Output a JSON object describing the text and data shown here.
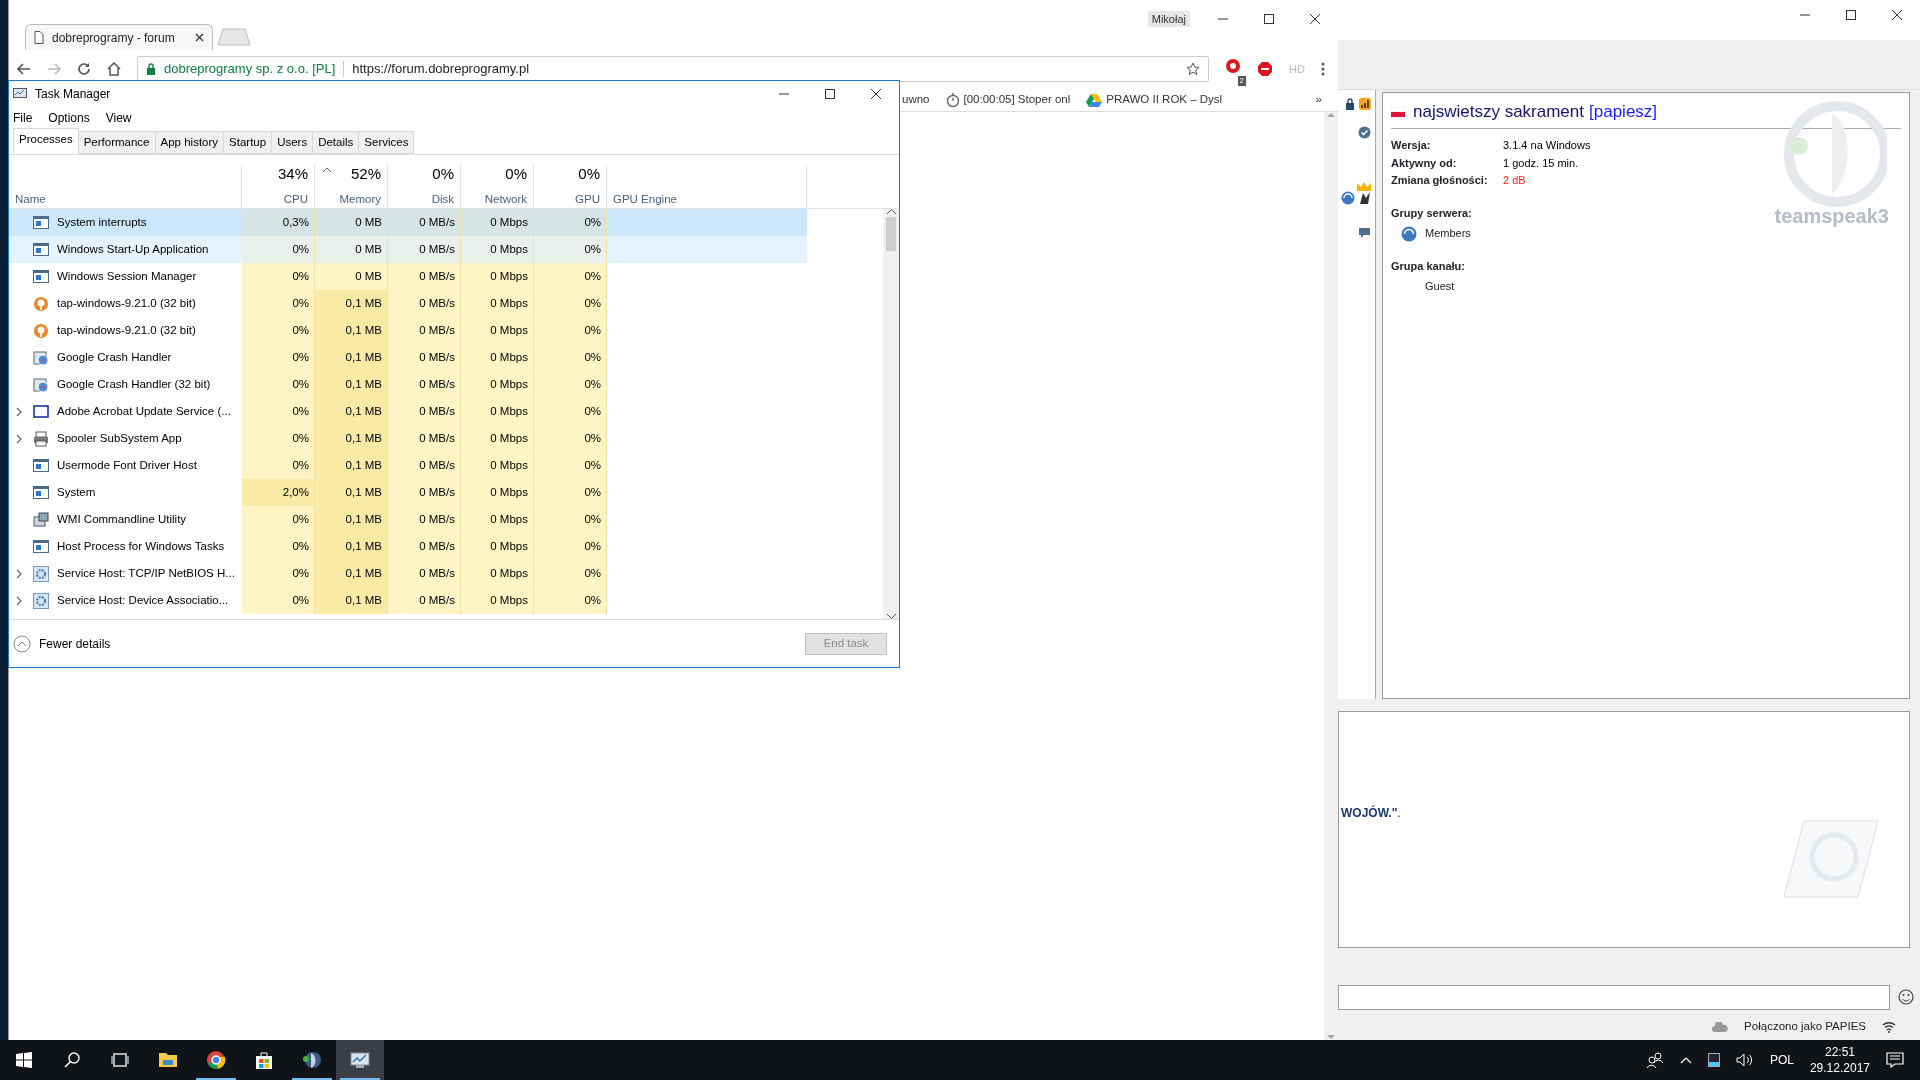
{
  "browser": {
    "tab_title": "dobreprogramy - forum",
    "profile": "Mikołaj",
    "address_owner": "dobreprogramy sp. z o.o. [PL]",
    "address_url": "https://forum.dobreprogramy.pl",
    "extension_badge": "2",
    "extension_label": "HD",
    "bookmarks": [
      {
        "label": "uwno",
        "kind": "plain"
      },
      {
        "label": "[00:00:05] Stoper onl",
        "kind": "timer"
      },
      {
        "label": "PRAWO II ROK – Dysl",
        "kind": "drive"
      }
    ],
    "overflow": "»"
  },
  "task_manager": {
    "title": "Task Manager",
    "menu": [
      "File",
      "Options",
      "View"
    ],
    "tabs": [
      {
        "label": "Processes",
        "selected": true
      },
      {
        "label": "Performance",
        "selected": false
      },
      {
        "label": "App history",
        "selected": false
      },
      {
        "label": "Startup",
        "selected": false
      },
      {
        "label": "Users",
        "selected": false
      },
      {
        "label": "Details",
        "selected": false
      },
      {
        "label": "Services",
        "selected": false
      }
    ],
    "columns": [
      {
        "label": "Name",
        "sorted": false
      },
      {
        "label": "CPU",
        "total": "34%",
        "sorted": false
      },
      {
        "label": "Memory",
        "total": "52%",
        "sorted": true
      },
      {
        "label": "Disk",
        "total": "0%",
        "sorted": false
      },
      {
        "label": "Network",
        "total": "0%",
        "sorted": false
      },
      {
        "label": "GPU",
        "total": "0%",
        "sorted": false
      },
      {
        "label": "GPU Engine",
        "sorted": false
      }
    ],
    "rows": [
      {
        "name": "System interrupts",
        "kind": "window",
        "expandable": false,
        "selected": true,
        "hovered": false,
        "cpu": "0,3%",
        "memory": "0 MB",
        "disk": "0 MB/s",
        "network": "0 Mbps",
        "gpu": "0%"
      },
      {
        "name": "Windows Start-Up Application",
        "kind": "window",
        "expandable": false,
        "selected": false,
        "hovered": true,
        "cpu": "0%",
        "memory": "0 MB",
        "disk": "0 MB/s",
        "network": "0 Mbps",
        "gpu": "0%"
      },
      {
        "name": "Windows Session Manager",
        "kind": "window",
        "expandable": false,
        "selected": false,
        "hovered": false,
        "cpu": "0%",
        "memory": "0 MB",
        "disk": "0 MB/s",
        "network": "0 Mbps",
        "gpu": "0%"
      },
      {
        "name": "tap-windows-9.21.0 (32 bit)",
        "kind": "tap",
        "expandable": false,
        "selected": false,
        "hovered": false,
        "cpu": "0%",
        "memory": "0,1 MB",
        "disk": "0 MB/s",
        "network": "0 Mbps",
        "gpu": "0%"
      },
      {
        "name": "tap-windows-9.21.0 (32 bit)",
        "kind": "tap",
        "expandable": false,
        "selected": false,
        "hovered": false,
        "cpu": "0%",
        "memory": "0,1 MB",
        "disk": "0 MB/s",
        "network": "0 Mbps",
        "gpu": "0%"
      },
      {
        "name": "Google Crash Handler",
        "kind": "crash",
        "expandable": false,
        "selected": false,
        "hovered": false,
        "cpu": "0%",
        "memory": "0,1 MB",
        "disk": "0 MB/s",
        "network": "0 Mbps",
        "gpu": "0%"
      },
      {
        "name": "Google Crash Handler (32 bit)",
        "kind": "crash",
        "expandable": false,
        "selected": false,
        "hovered": false,
        "cpu": "0%",
        "memory": "0,1 MB",
        "disk": "0 MB/s",
        "network": "0 Mbps",
        "gpu": "0%"
      },
      {
        "name": "Adobe Acrobat Update Service (...",
        "kind": "frame",
        "expandable": true,
        "selected": false,
        "hovered": false,
        "cpu": "0%",
        "memory": "0,1 MB",
        "disk": "0 MB/s",
        "network": "0 Mbps",
        "gpu": "0%"
      },
      {
        "name": "Spooler SubSystem App",
        "kind": "printer",
        "expandable": true,
        "selected": false,
        "hovered": false,
        "cpu": "0%",
        "memory": "0,1 MB",
        "disk": "0 MB/s",
        "network": "0 Mbps",
        "gpu": "0%"
      },
      {
        "name": "Usermode Font Driver Host",
        "kind": "window",
        "expandable": false,
        "selected": false,
        "hovered": false,
        "cpu": "0%",
        "memory": "0,1 MB",
        "disk": "0 MB/s",
        "network": "0 Mbps",
        "gpu": "0%"
      },
      {
        "name": "System",
        "kind": "window",
        "expandable": false,
        "selected": false,
        "hovered": false,
        "cpu": "2,0%",
        "memory": "0,1 MB",
        "disk": "0 MB/s",
        "network": "0 Mbps",
        "gpu": "0%"
      },
      {
        "name": "WMI Commandline Utility",
        "kind": "wmi",
        "expandable": false,
        "selected": false,
        "hovered": false,
        "cpu": "0%",
        "memory": "0,1 MB",
        "disk": "0 MB/s",
        "network": "0 Mbps",
        "gpu": "0%"
      },
      {
        "name": "Host Process for Windows Tasks",
        "kind": "window",
        "expandable": false,
        "selected": false,
        "hovered": false,
        "cpu": "0%",
        "memory": "0,1 MB",
        "disk": "0 MB/s",
        "network": "0 Mbps",
        "gpu": "0%"
      },
      {
        "name": "Service Host: TCP/IP NetBIOS H...",
        "kind": "gear",
        "expandable": true,
        "selected": false,
        "hovered": false,
        "cpu": "0%",
        "memory": "0,1 MB",
        "disk": "0 MB/s",
        "network": "0 Mbps",
        "gpu": "0%"
      },
      {
        "name": "Service Host: Device Associatio...",
        "kind": "gear",
        "expandable": true,
        "selected": false,
        "hovered": false,
        "cpu": "0%",
        "memory": "0,1 MB",
        "disk": "0 MB/s",
        "network": "0 Mbps",
        "gpu": "0%"
      }
    ],
    "fewer_details": "Fewer details",
    "end_task": {
      "label": "End task",
      "disabled": true
    }
  },
  "teamspeak": {
    "client_name": "najswietszy sakrament",
    "client_tag": "[papiesz]",
    "info": [
      {
        "label": "Wersja:",
        "value": "3.1.4 na Windows",
        "kind": "normal"
      },
      {
        "label": "Aktywny od:",
        "value": "1 godz. 15 min.",
        "kind": "normal"
      },
      {
        "label": "Zmiana głośności:",
        "value": "2 dB",
        "kind": "alert"
      }
    ],
    "server_groups_label": "Grupy serwera:",
    "server_groups": [
      "Members"
    ],
    "channel_group_label": "Grupa kanału:",
    "channel_groups": [
      "Guest"
    ],
    "logo_text": "teamspeak3",
    "chat_line": "**WOJÓW.\"**.",
    "status": "Połączono jako PAPIES"
  },
  "taskbar": {
    "apps": [
      {
        "kind": "explorer",
        "running": false,
        "active": false
      },
      {
        "kind": "chrome",
        "running": true,
        "active": false
      },
      {
        "kind": "store",
        "running": false,
        "active": false
      },
      {
        "kind": "teamspeak",
        "running": true,
        "active": false
      },
      {
        "kind": "taskmanager",
        "running": true,
        "active": true
      }
    ],
    "language": "POL",
    "time": "22:51",
    "date": "29.12.2017"
  }
}
